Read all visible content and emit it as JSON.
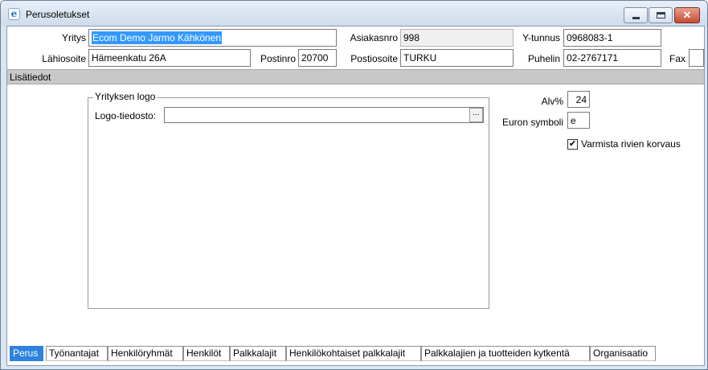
{
  "window": {
    "title": "Perusoletukset",
    "app_icon": "e",
    "close_glyph": "✕"
  },
  "form": {
    "yritys_label": "Yritys",
    "yritys_value": "Ecom Demo Jarmo Kähkönen",
    "asiakasnro_label": "Asiakasnro",
    "asiakasnro_value": "998",
    "ytunnus_label": "Y-tunnus",
    "ytunnus_value": "0968083-1",
    "lahiosoite_label": "Lähiosoite",
    "lahiosoite_value": "Hämeenkatu 26A",
    "postinro_label": "Postinro",
    "postinro_value": "20700",
    "postiosoite_label": "Postiosoite",
    "postiosoite_value": "TURKU",
    "puhelin_label": "Puhelin",
    "puhelin_value": "02-2767171",
    "fax_label": "Fax",
    "fax_value": ""
  },
  "section": {
    "title": "Lisätiedot"
  },
  "logo": {
    "group_title": "Yrityksen logo",
    "file_label": "Logo-tiedosto:",
    "file_value": "",
    "browse_label": "..."
  },
  "settings": {
    "alv_label": "Alv%",
    "alv_value": "24",
    "euro_label": "Euron symboli",
    "euro_value": "e",
    "confirm_label": "Varmista rivien korvaus",
    "confirm_checked": true,
    "check_glyph": "✔"
  },
  "tabs": [
    {
      "label": "Perus",
      "active": true
    },
    {
      "label": "Työnantajat"
    },
    {
      "label": "Henkilöryhmät"
    },
    {
      "label": "Henkilöt"
    },
    {
      "label": "Palkkalajit"
    },
    {
      "label": "Henkilökohtaiset palkkalajit"
    },
    {
      "label": "Palkkalajien ja tuotteiden kytkentä"
    },
    {
      "label": "Organisaatio"
    }
  ]
}
